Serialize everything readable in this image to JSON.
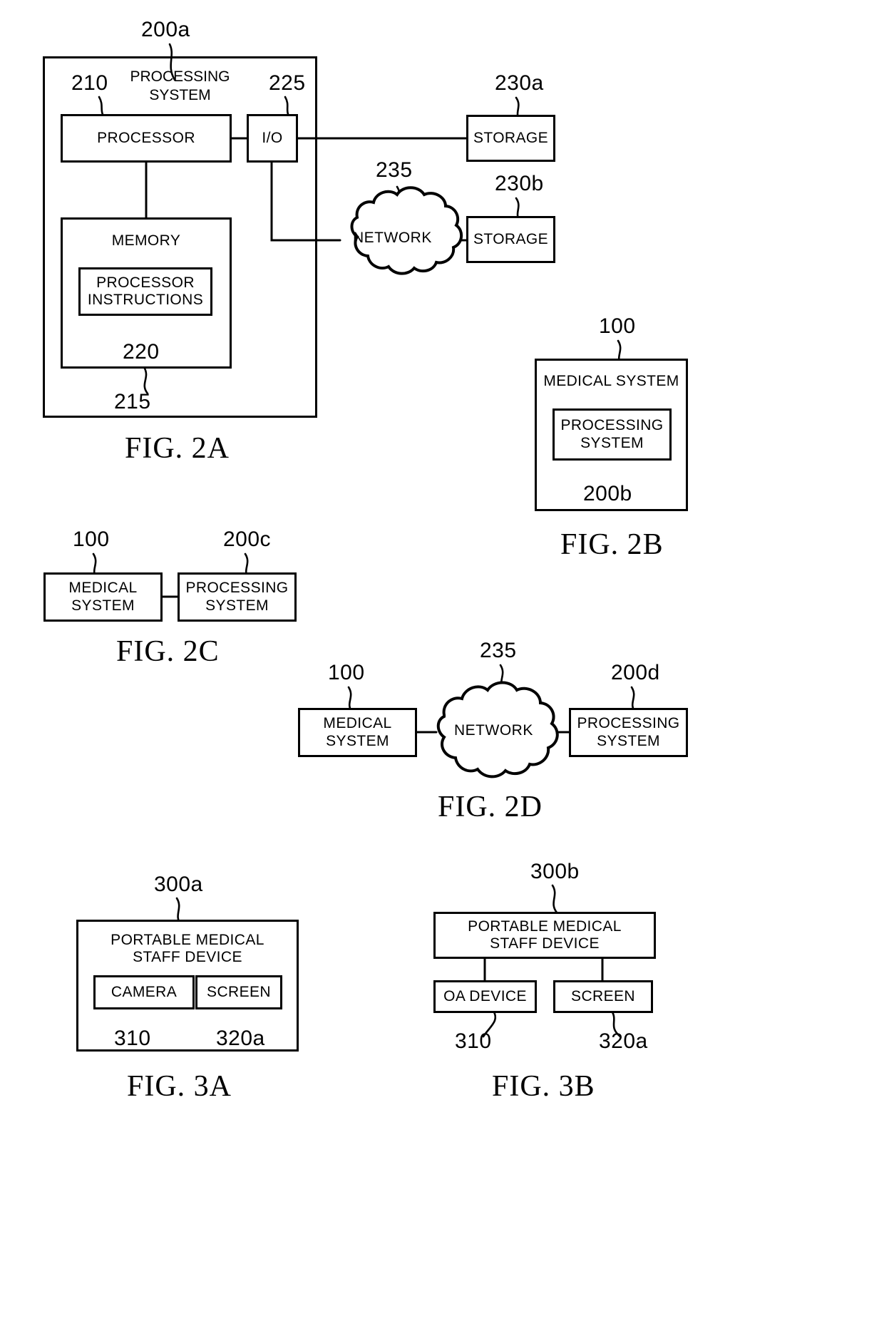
{
  "sheet": {
    "figures": [
      {
        "caption": "FIG. 2A",
        "ref": "200a",
        "outer_title": "PROCESSING\nSYSTEM",
        "nodes": [
          {
            "label": "PROCESSOR",
            "ref": "210"
          },
          {
            "label": "I/O",
            "ref": "225"
          },
          {
            "label": "MEMORY",
            "ref": "215"
          },
          {
            "label": "PROCESSOR\nINSTRUCTIONS",
            "ref": "220"
          },
          {
            "label": "NETWORK",
            "ref": "235"
          },
          {
            "label": "STORAGE",
            "ref": "230a"
          },
          {
            "label": "STORAGE",
            "ref": "230b"
          }
        ]
      },
      {
        "caption": "FIG. 2B",
        "ref": "100",
        "nodes": [
          {
            "label": "MEDICAL SYSTEM",
            "ref": "100"
          },
          {
            "label": "PROCESSING\nSYSTEM",
            "ref": "200b"
          }
        ]
      },
      {
        "caption": "FIG. 2C",
        "nodes": [
          {
            "label": "MEDICAL\nSYSTEM",
            "ref": "100"
          },
          {
            "label": "PROCESSING\nSYSTEM",
            "ref": "200c"
          }
        ]
      },
      {
        "caption": "FIG. 2D",
        "nodes": [
          {
            "label": "MEDICAL\nSYSTEM",
            "ref": "100"
          },
          {
            "label": "NETWORK",
            "ref": "235"
          },
          {
            "label": "PROCESSING\nSYSTEM",
            "ref": "200d"
          }
        ]
      },
      {
        "caption": "FIG. 3A",
        "nodes": [
          {
            "label": "PORTABLE MEDICAL\nSTAFF DEVICE",
            "ref": "300a"
          },
          {
            "label": "CAMERA",
            "ref": "310"
          },
          {
            "label": "SCREEN",
            "ref": "320a"
          }
        ]
      },
      {
        "caption": "FIG. 3B",
        "nodes": [
          {
            "label": "PORTABLE MEDICAL\nSTAFF DEVICE",
            "ref": "300b"
          },
          {
            "label": "OA DEVICE",
            "ref": "310"
          },
          {
            "label": "SCREEN",
            "ref": "320a"
          }
        ]
      }
    ]
  },
  "fig2a": {
    "caption": "FIG. 2A",
    "ref_200a": "200a",
    "outer_title_line1": "PROCESSING",
    "outer_title_line2": "SYSTEM",
    "ref_210": "210",
    "processor": "PROCESSOR",
    "ref_225": "225",
    "io": "I/O",
    "memory": "MEMORY",
    "ref_215": "215",
    "instr_line1": "PROCESSOR",
    "instr_line2": "INSTRUCTIONS",
    "ref_220": "220",
    "ref_235": "235",
    "network": "NETWORK",
    "ref_230a": "230a",
    "storage_a": "STORAGE",
    "ref_230b": "230b",
    "storage_b": "STORAGE"
  },
  "fig2b": {
    "caption": "FIG. 2B",
    "ref_100": "100",
    "medical_system": "MEDICAL SYSTEM",
    "proc_line1": "PROCESSING",
    "proc_line2": "SYSTEM",
    "ref_200b": "200b"
  },
  "fig2c": {
    "caption": "FIG. 2C",
    "ref_100": "100",
    "ref_200c": "200c",
    "med_line1": "MEDICAL",
    "med_line2": "SYSTEM",
    "proc_line1": "PROCESSING",
    "proc_line2": "SYSTEM"
  },
  "fig2d": {
    "caption": "FIG. 2D",
    "ref_100": "100",
    "ref_235": "235",
    "ref_200d": "200d",
    "med_line1": "MEDICAL",
    "med_line2": "SYSTEM",
    "network": "NETWORK",
    "proc_line1": "PROCESSING",
    "proc_line2": "SYSTEM"
  },
  "fig3a": {
    "caption": "FIG. 3A",
    "ref_300a": "300a",
    "device_line1": "PORTABLE MEDICAL",
    "device_line2": "STAFF DEVICE",
    "camera": "CAMERA",
    "ref_310": "310",
    "screen": "SCREEN",
    "ref_320a": "320a"
  },
  "fig3b": {
    "caption": "FIG. 3B",
    "ref_300b": "300b",
    "device_line1": "PORTABLE MEDICAL",
    "device_line2": "STAFF DEVICE",
    "oa_device": "OA DEVICE",
    "ref_310": "310",
    "screen": "SCREEN",
    "ref_320a": "320a"
  }
}
